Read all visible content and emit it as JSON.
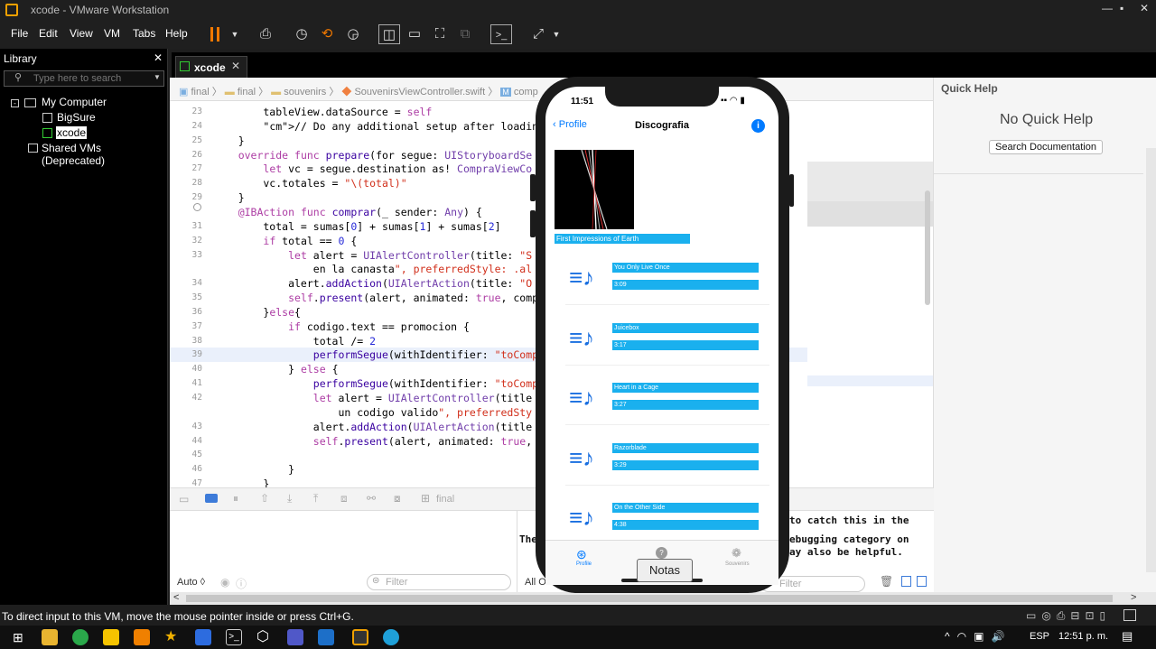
{
  "window": {
    "title": "xcode - VMware Workstation"
  },
  "menu": [
    "File",
    "Edit",
    "View",
    "VM",
    "Tabs",
    "Help"
  ],
  "library": {
    "title": "Library",
    "search_placeholder": "Type here to search",
    "items": [
      "My Computer",
      "BigSure",
      "xcode",
      "Shared VMs (Deprecated)"
    ]
  },
  "vm_tab": {
    "label": "xcode"
  },
  "breadcrumb": [
    "final",
    "final",
    "souvenirs",
    "SouvenirsViewController.swift",
    "comp"
  ],
  "code_lines": [
    {
      "n": "23",
      "text": "        tableView.dataSource = self"
    },
    {
      "n": "24",
      "text": "        // Do any additional setup after loading the"
    },
    {
      "n": "25",
      "text": "    }"
    },
    {
      "n": "26",
      "text": "    override func prepare(for segue: UIStoryboardSe"
    },
    {
      "n": "27",
      "text": "        let vc = segue.destination as! CompraViewCo"
    },
    {
      "n": "28",
      "text": "        vc.totales = \"\\(total)\""
    },
    {
      "n": "29",
      "text": "    }"
    },
    {
      "n": "",
      "text": "    @IBAction func comprar(_ sender: Any) {"
    },
    {
      "n": "31",
      "text": "        total = sumas[0] + sumas[1] + sumas[2]"
    },
    {
      "n": "32",
      "text": "        if total == 0 {"
    },
    {
      "n": "33",
      "text": "            let alert = UIAlertController(title: \"S"
    },
    {
      "n": "",
      "text": "                en la canasta\", preferredStyle: .al"
    },
    {
      "n": "34",
      "text": "            alert.addAction(UIAlertAction(title: \"O"
    },
    {
      "n": "35",
      "text": "            self.present(alert, animated: true, comp"
    },
    {
      "n": "36",
      "text": "        }else{"
    },
    {
      "n": "37",
      "text": "            if codigo.text == promocion {"
    },
    {
      "n": "38",
      "text": "                total /= 2"
    },
    {
      "n": "39",
      "text": "                performSegue(withIdentifier: \"toComp"
    },
    {
      "n": "40",
      "text": "            } else {"
    },
    {
      "n": "41",
      "text": "                performSegue(withIdentifier: \"toComp"
    },
    {
      "n": "42",
      "text": "                let alert = UIAlertController(title"
    },
    {
      "n": "",
      "text": "                    un codigo valido\", preferredSty"
    },
    {
      "n": "43",
      "text": "                alert.addAction(UIAlertAction(title"
    },
    {
      "n": "44",
      "text": "                self.present(alert, animated: true,"
    },
    {
      "n": "45",
      "text": ""
    },
    {
      "n": "46",
      "text": "            }"
    },
    {
      "n": "47",
      "text": "        }"
    }
  ],
  "debug_bar": {
    "scheme": "final"
  },
  "console": {
    "auto_label": "Auto ◊",
    "filter_placeholder": "Filter",
    "all_label": "All O",
    "right_filter_placeholder": "Filter",
    "text1": "to catch this in the",
    "text2": "The",
    "text3": "ebugging category on",
    "text4": "ay also be helpful."
  },
  "quick_help": {
    "title": "Quick Help",
    "empty": "No Quick Help",
    "button": "Search Documentation"
  },
  "phone": {
    "time": "11:51",
    "back": "Profile",
    "title": "Discografia",
    "album_title": "First Impressions of Earth",
    "songs": [
      {
        "name": "You Only Live Once",
        "duration": "3:09"
      },
      {
        "name": "Juicebox",
        "duration": "3:17"
      },
      {
        "name": "Heart in a Cage",
        "duration": "3:27"
      },
      {
        "name": "Razorblade",
        "duration": "3:29"
      },
      {
        "name": "On the Other Side",
        "duration": "4:38"
      }
    ],
    "tabs": [
      "Profile",
      "",
      "Souvenirs"
    ],
    "tooltip": "Notas"
  },
  "statusbar": {
    "hint": "To direct input to this VM, move the mouse pointer inside or press Ctrl+G."
  },
  "taskbar": {
    "language": "ESP",
    "time": "12:51 p. m."
  },
  "colors": {
    "accent": "#1ab0ee",
    "ios_blue": "#007aff"
  }
}
